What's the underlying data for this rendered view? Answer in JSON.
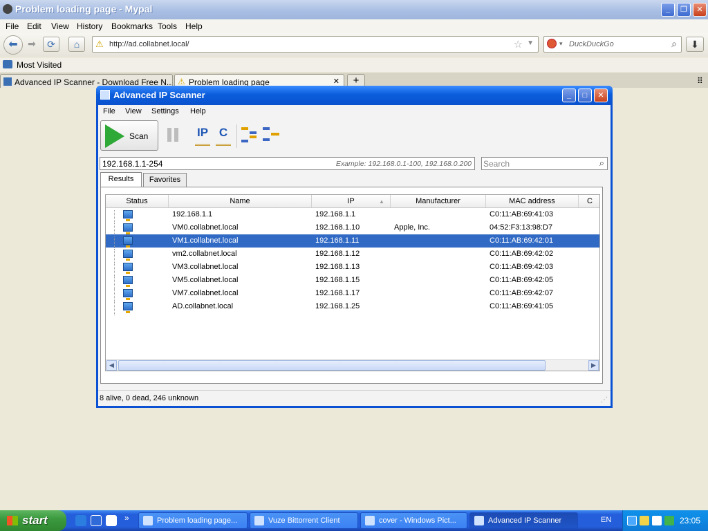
{
  "browser": {
    "title": "Problem loading page - Mypal",
    "menu": [
      "File",
      "Edit",
      "View",
      "History",
      "Bookmarks",
      "Tools",
      "Help"
    ],
    "url": "http://ad.collabnet.local/",
    "search_placeholder": "DuckDuckGo",
    "bookmark": "Most Visited",
    "tabs": [
      {
        "label": "Advanced IP Scanner - Download Free N..."
      },
      {
        "label": "Problem loading page"
      }
    ],
    "new_tab": "+",
    "icons": {
      "back": "back-arrow-icon",
      "forward": "forward-arrow-icon",
      "reload": "reload-icon",
      "home": "home-icon",
      "download": "download-icon"
    }
  },
  "scanner": {
    "title": "Advanced IP Scanner",
    "menu": [
      "File",
      "View",
      "Settings",
      "Help"
    ],
    "scan_label": "Scan",
    "ip_icon_label": "IP",
    "c_icon_label": "C",
    "ip_range": "192.168.1.1-254",
    "example": "Example: 192.168.0.1-100, 192.168.0.200",
    "search_placeholder": "Search",
    "tabs": [
      "Results",
      "Favorites"
    ],
    "columns": [
      "Status",
      "Name",
      "IP",
      "Manufacturer",
      "MAC address",
      "C"
    ],
    "rows": [
      {
        "name": "192.168.1.1",
        "ip": "192.168.1.1",
        "manufacturer": "",
        "mac": "C0:11:AB:69:41:03"
      },
      {
        "name": "VM0.collabnet.local",
        "ip": "192.168.1.10",
        "manufacturer": "Apple, Inc.",
        "mac": "04:52:F3:13:98:D7"
      },
      {
        "name": "VM1.collabnet.local",
        "ip": "192.168.1.11",
        "manufacturer": "",
        "mac": "C0:11:AB:69:42:01"
      },
      {
        "name": "vm2.collabnet.local",
        "ip": "192.168.1.12",
        "manufacturer": "",
        "mac": "C0:11:AB:69:42:02"
      },
      {
        "name": "VM3.collabnet.local",
        "ip": "192.168.1.13",
        "manufacturer": "",
        "mac": "C0:11:AB:69:42:03"
      },
      {
        "name": "VM5.collabnet.local",
        "ip": "192.168.1.15",
        "manufacturer": "",
        "mac": "C0:11:AB:69:42:05"
      },
      {
        "name": "VM7.collabnet.local",
        "ip": "192.168.1.17",
        "manufacturer": "",
        "mac": "C0:11:AB:69:42:07"
      },
      {
        "name": "AD.collabnet.local",
        "ip": "192.168.1.25",
        "manufacturer": "",
        "mac": "C0:11:AB:69:41:05"
      }
    ],
    "selected_row": 2,
    "status": "8 alive, 0 dead, 246 unknown"
  },
  "taskbar": {
    "start": "start",
    "tasks": [
      {
        "label": "Problem loading page..."
      },
      {
        "label": "Vuze Bittorrent Client"
      },
      {
        "label": "cover - Windows Pict..."
      },
      {
        "label": "Advanced IP Scanner"
      }
    ],
    "quicklaunch_more": "»",
    "lang": "EN",
    "clock": "23:05"
  },
  "colors": {
    "xp_blue": "#0a51d4",
    "selection": "#316ac5",
    "start_green": "#3c9a3f"
  }
}
